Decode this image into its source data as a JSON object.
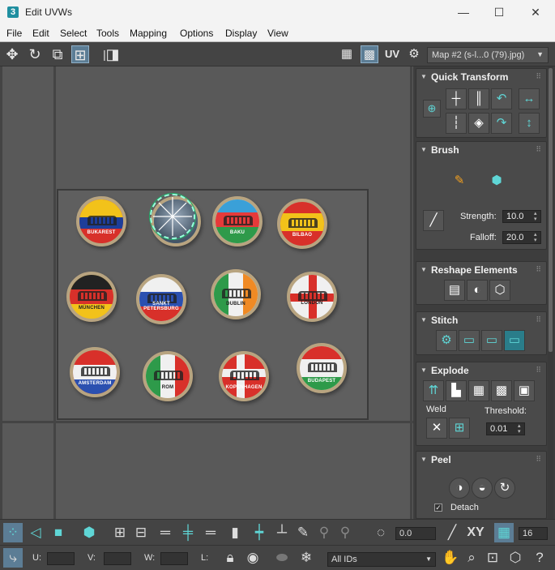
{
  "window": {
    "app_icon_label": "3",
    "title": "Edit UVWs",
    "minimize": "—",
    "maximize": "☐",
    "close": "✕"
  },
  "menu": [
    "File",
    "Edit",
    "Select",
    "Tools",
    "Mapping",
    "Options",
    "Display",
    "View"
  ],
  "toolbar": {
    "uv_label": "UV",
    "map_select": "Map #2 (s-l...0 (79).jpg)"
  },
  "caps": [
    "BUKAREST",
    "",
    "BAKU",
    "BILBAO",
    "MÜNCHEN",
    "SANKT PETERSBURG",
    "DUBLIN",
    "LONDON",
    "AMSTERDAM",
    "ROM",
    "KOPENHAGEN",
    "BUDAPEST"
  ],
  "panel": {
    "quick_transform": "Quick Transform",
    "brush": "Brush",
    "strength_label": "Strength:",
    "strength_value": "10.0",
    "falloff_label": "Falloff:",
    "falloff_value": "20.0",
    "reshape": "Reshape Elements",
    "stitch": "Stitch",
    "explode": "Explode",
    "weld_label": "Weld",
    "threshold_label": "Threshold:",
    "threshold_value": "0.01",
    "peel": "Peel",
    "detach_label": "Detach"
  },
  "bottom": {
    "angle_value": "0.0",
    "xy_label": "XY",
    "grid_value": "16",
    "u_label": "U:",
    "v_label": "V:",
    "w_label": "W:",
    "l_label": "L:",
    "ids_select": "All IDs"
  }
}
